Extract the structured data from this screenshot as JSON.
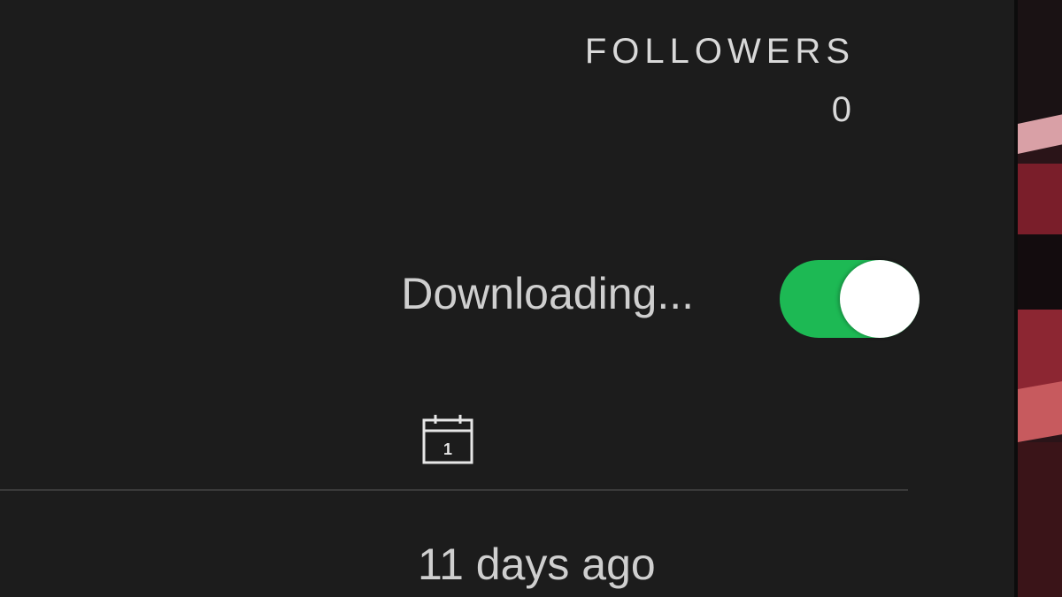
{
  "playlist_header": {
    "followers_label": "FOLLOWERS",
    "followers_count": "0"
  },
  "download": {
    "label": "Downloading...",
    "toggle_on": true,
    "toggle_color": "#1db954"
  },
  "table_header": {
    "date_column_icon": "calendar-icon",
    "calendar_icon_digit": "1"
  },
  "track_row": {
    "date_added": "11 days ago"
  },
  "colors": {
    "background": "#1c1c1c",
    "text": "#cfcfcf",
    "accent": "#1db954"
  }
}
